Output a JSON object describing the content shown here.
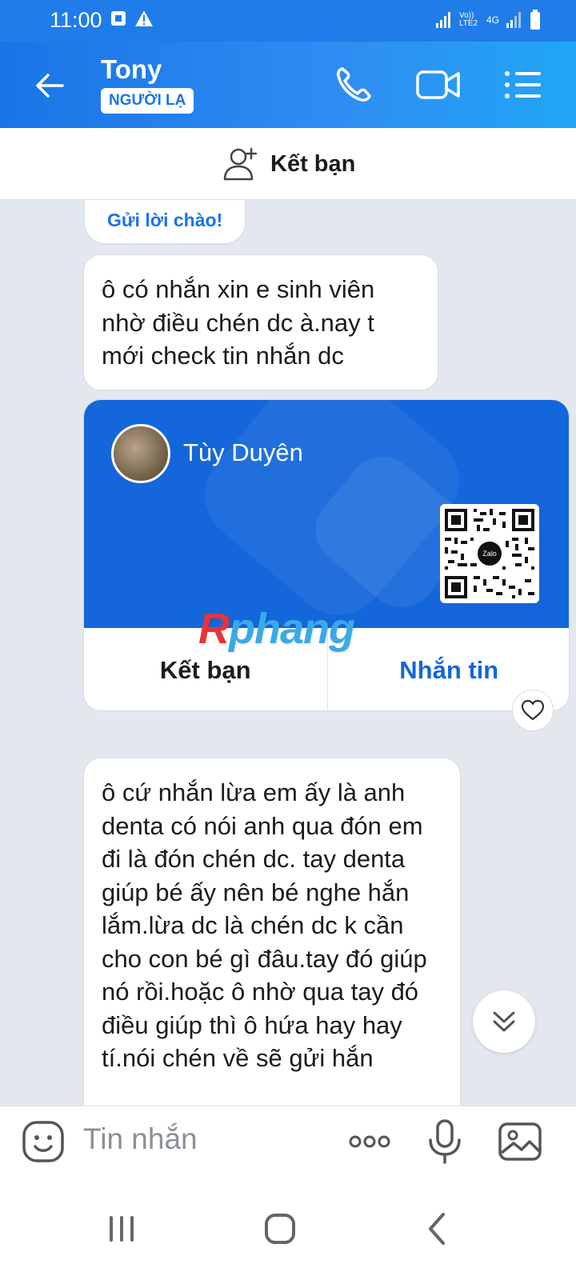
{
  "status_bar": {
    "time": "11:00",
    "network": "4G",
    "carrier_label": "Vo)) LTE2"
  },
  "header": {
    "name": "Tony",
    "badge": "NGƯỜI LẠ"
  },
  "add_friend": {
    "label": "Kết bạn"
  },
  "chat": {
    "greeting_chip": "Gửi lời chào!",
    "message1": "ô có nhắn xin e sinh viên nhờ điều chén dc à.nay t mới check tin nhắn dc",
    "card": {
      "name": "Tùy Duyên",
      "qr_logo": "Zalo",
      "add_friend_label": "Kết bạn",
      "message_label": "Nhắn tin"
    },
    "message2": "ô cứ nhắn lừa em ấy là anh denta có nói anh qua đón em đi là đón chén dc. tay denta giúp bé ấy nên bé nghe hắn lắm.lừa dc là chén dc k cần cho con bé gì đâu.tay đó giúp nó rồi.hoặc ô nhờ qua tay đó điều giúp thì ô hứa hay hay tí.nói chén về sẽ gửi hắn"
  },
  "watermark": {
    "part1": "R",
    "part2": "phang"
  },
  "input": {
    "placeholder": "Tin nhắn"
  },
  "colors": {
    "primary": "#1466db",
    "header": "#2f8df2",
    "background": "#e3e8ef"
  },
  "icons": {
    "back": "back-arrow-icon",
    "call": "phone-icon",
    "video": "video-icon",
    "menu": "menu-icon",
    "add_friend": "add-user-icon",
    "heart": "heart-icon",
    "scroll_down": "chevron-double-down-icon",
    "emoji": "emoji-icon",
    "more": "more-icon",
    "mic": "mic-icon",
    "image": "image-icon"
  }
}
